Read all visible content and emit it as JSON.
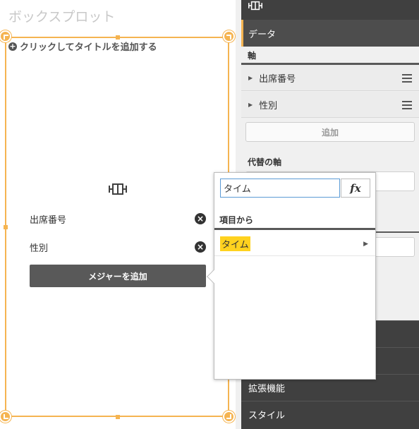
{
  "chart": {
    "title": "ボックスプロット",
    "add_title_label": "クリックしてタイトルを追加する",
    "dimensions": [
      "出席番号",
      "性別"
    ],
    "add_measure_label": "メジャーを追加"
  },
  "panel": {
    "tab_data_label": "データ",
    "axis_section": "軸",
    "axis_items": [
      "出席番号",
      "性別"
    ],
    "add_label": "追加",
    "alt_axis_section": "代替の軸",
    "nav_items": [
      "拡張機能",
      "スタイル"
    ]
  },
  "popup": {
    "search_value": "タイム",
    "fx_label": "fx",
    "section_label": "項目から",
    "result_label": "タイム"
  },
  "colors": {
    "selection": "#f5b451",
    "panel_bg": "#404040",
    "button_dark": "#595959",
    "highlight": "#ffd21f"
  }
}
